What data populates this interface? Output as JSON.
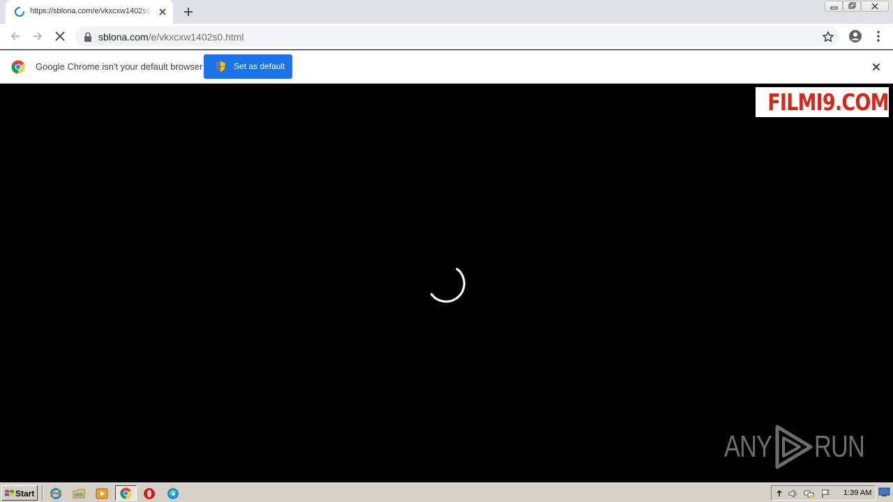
{
  "browser": {
    "tab": {
      "title": "https://sblona.com/e/vkxcxw1402s0.html"
    },
    "omnibox": {
      "url_host": "sblona.com",
      "url_path": "/e/vkxcxw1402s0.html"
    }
  },
  "infobar": {
    "message": "Google Chrome isn't your default browser",
    "button_label": "Set as default"
  },
  "content": {
    "logo_text": "FILMI9.COM"
  },
  "watermark": {
    "any": "ANY",
    "run": "RUN"
  },
  "taskbar": {
    "start_label": "Start",
    "clock": "1:39 AM"
  },
  "colors": {
    "chrome_blue": "#1a73e8",
    "logo_red": "#d12a1c",
    "tab_strip": "#dee1e6"
  }
}
